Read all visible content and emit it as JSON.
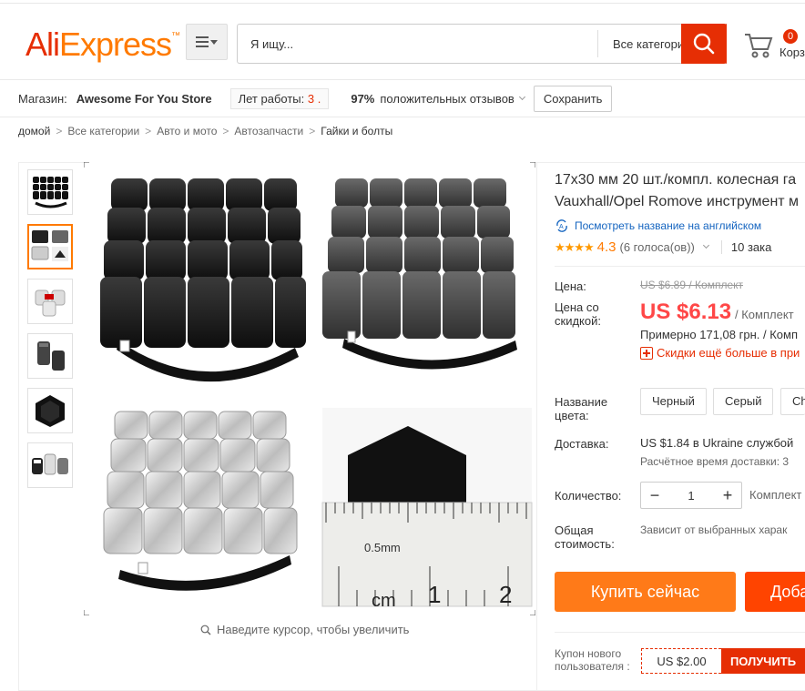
{
  "header": {
    "logo_ali": "Ali",
    "logo_express": "Express",
    "logo_tm": "™",
    "search_placeholder": "Я ищу...",
    "search_category": "Все категории",
    "cart_count": "0",
    "cart_label": "Корз"
  },
  "store": {
    "label": "Магазин:",
    "name": "Awesome For You Store",
    "years_label": "Лет работы:",
    "years_value": "3 .",
    "feedback_pct": "97%",
    "feedback_label": "положительных отзывов",
    "save_label": "Сохранить"
  },
  "breadcrumb": [
    "домой",
    "Все категории",
    "Авто и мото",
    "Автозапчасти",
    "Гайки и болты"
  ],
  "gallery": {
    "zoom_hint": "Наведите курсор, чтобы увеличить",
    "thumbnails": [
      "black caps",
      "four variants",
      "silver caps",
      "single cap",
      "hex cap top",
      "mixed caps"
    ],
    "active_thumbnail": 1,
    "ruler": {
      "unit_label": "cm",
      "mark1": "1",
      "mark2": "2",
      "scale_label": "0.5mm"
    }
  },
  "product": {
    "title_line1": "17x30 мм 20 шт./компл. колесная га",
    "title_line2": "Vauxhall/Opel Romove инструмент м",
    "translate_link": "Посмотреть название на английском",
    "stars": "★★★★",
    "rating": "4.3",
    "votes": "(6 голоса(ов))",
    "orders": "10 зака"
  },
  "pricing": {
    "price_label": "Цена:",
    "old_price": "US $6.89 / Комплект",
    "discount_label_1": "Цена со",
    "discount_label_2": "скидкой:",
    "new_price": "US $6.13",
    "per_unit": "/ Комплект",
    "approx": "Примерно 171,08 грн. / Комп",
    "more_discount": "Скидки ещё больше в при"
  },
  "options": {
    "color_label_1": "Название",
    "color_label_2": "цвета:",
    "colors": [
      "Черный",
      "Серый",
      "Ch"
    ],
    "delivery_label": "Доставка:",
    "delivery_value": "US $1.84 в Ukraine службой",
    "delivery_time": "Расчётное время доставки: 3",
    "qty_label": "Количество:",
    "qty_value": "1",
    "qty_minus": "−",
    "qty_plus": "+",
    "qty_unit": "Комплект",
    "total_label_1": "Общая",
    "total_label_2": "стоимость:",
    "total_value": "Зависит от выбранных харак"
  },
  "actions": {
    "buy_now": "Купить сейчас",
    "add_to_cart": "Доба"
  },
  "coupon": {
    "label": "Купон нового пользователя :",
    "value": "US $2.00",
    "get": "ПОЛУЧИТЬ"
  },
  "colors": {
    "brand_red": "#e62e04",
    "brand_orange": "#ff7a00",
    "price_red": "#ff4747",
    "link_blue": "#1565c0"
  }
}
